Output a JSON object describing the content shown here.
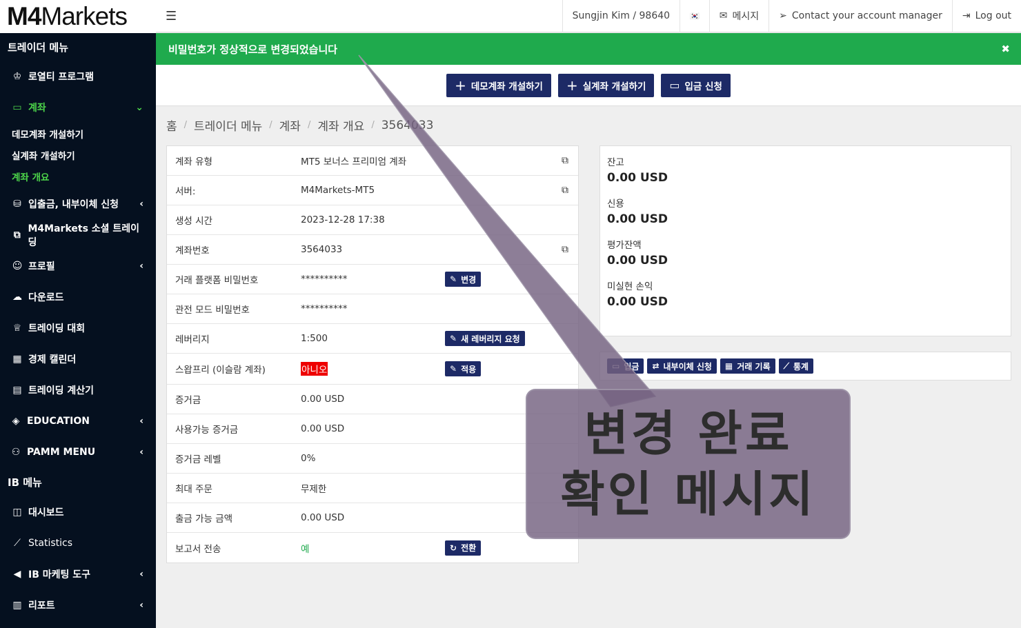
{
  "brand": {
    "logo_m4": "M4",
    "logo_rest": "Markets"
  },
  "sidebar": {
    "trader_menu_title": "트레이더 메뉴",
    "items": [
      {
        "label": "로열티 프로그램",
        "icon": "crown-icon"
      },
      {
        "label": "계좌",
        "icon": "wallet-icon"
      },
      {
        "label": "입출금, 내부이체 신청",
        "icon": "coins-icon"
      },
      {
        "label": "M4Markets 소셜 트레이딩",
        "icon": "copy-icon"
      },
      {
        "label": "프로필",
        "icon": "user-icon"
      },
      {
        "label": "다운로드",
        "icon": "cloud-download-icon"
      },
      {
        "label": "트레이딩 대회",
        "icon": "trophy-icon"
      },
      {
        "label": "경제 캘린더",
        "icon": "calendar-icon"
      },
      {
        "label": "트레이딩 계산기",
        "icon": "calculator-icon"
      },
      {
        "label": "EDUCATION",
        "icon": "graduation-cap-icon"
      },
      {
        "label": "PAMM MENU",
        "icon": "hand-coins-icon"
      }
    ],
    "account_sub": [
      "데모계좌 개설하기",
      "실계좌 개설하기",
      "계좌 개요"
    ],
    "ib_menu_title": "IB 메뉴",
    "ib_items": [
      {
        "label": "대시보드",
        "icon": "dashboard-icon"
      },
      {
        "label": "Statistics",
        "icon": "chart-line-icon"
      },
      {
        "label": "IB 마케팅 도구",
        "icon": "bullhorn-icon"
      },
      {
        "label": "리포트",
        "icon": "report-icon"
      }
    ]
  },
  "topbar": {
    "user": "Sungjin Kim / 98640",
    "flag": "🇰🇷",
    "messages": "메시지",
    "contact": "Contact your account manager",
    "logout": "Log out"
  },
  "banner": {
    "text": "비밀번호가 정상적으로 변경되었습니다",
    "close": "✖"
  },
  "actions": {
    "demo": "데모계좌 개설하기",
    "real": "실계좌 개설하기",
    "deposit": "입금 신청"
  },
  "breadcrumb": [
    "홈",
    "트레이더 메뉴",
    "계좌",
    "계좌 개요",
    "3564033"
  ],
  "account": {
    "rows": [
      {
        "label": "계좌 유형",
        "value": "MT5 보너스 프리미엄 계좌"
      },
      {
        "label": "서버:",
        "value": "M4Markets-MT5"
      },
      {
        "label": "생성 시간",
        "value": "2023-12-28 17:38"
      },
      {
        "label": "계좌번호",
        "value": "3564033"
      },
      {
        "label": "거래 플랫폼 비밀번호",
        "value": "**********"
      },
      {
        "label": "관전 모드 비밀번호",
        "value": "**********"
      },
      {
        "label": "레버리지",
        "value": "1:500"
      },
      {
        "label": "스왑프리 (이슬람 계좌)",
        "value": "아니오"
      },
      {
        "label": "증거금",
        "value": "0.00 USD"
      },
      {
        "label": "사용가능 증거금",
        "value": "0.00 USD"
      },
      {
        "label": "증거금 레벨",
        "value": "0%"
      },
      {
        "label": "최대 주문",
        "value": "무제한"
      },
      {
        "label": "출금 가능 금액",
        "value": "0.00 USD"
      },
      {
        "label": "보고서 전송",
        "value": "예"
      }
    ],
    "change_btn": "변경",
    "leverage_btn": "새 레버리지 요청",
    "apply_btn": "적용",
    "switch_btn": "전환"
  },
  "balance": {
    "items": [
      {
        "label": "잔고",
        "value": "0.00 USD"
      },
      {
        "label": "신용",
        "value": "0.00 USD"
      },
      {
        "label": "평가잔액",
        "value": "0.00 USD"
      },
      {
        "label": "미실현 손익",
        "value": "0.00 USD"
      }
    ],
    "buttons": [
      "입금",
      "내부이체 신청",
      "거래 기록",
      "통계"
    ]
  },
  "callout": {
    "line1": "변경 완료",
    "line2": "확인 메시지"
  },
  "colors": {
    "sidebar": "#05101f",
    "accent_green": "#4dd64a",
    "banner": "#1faa4d",
    "button": "#1d2a66",
    "callout": "#746280"
  }
}
